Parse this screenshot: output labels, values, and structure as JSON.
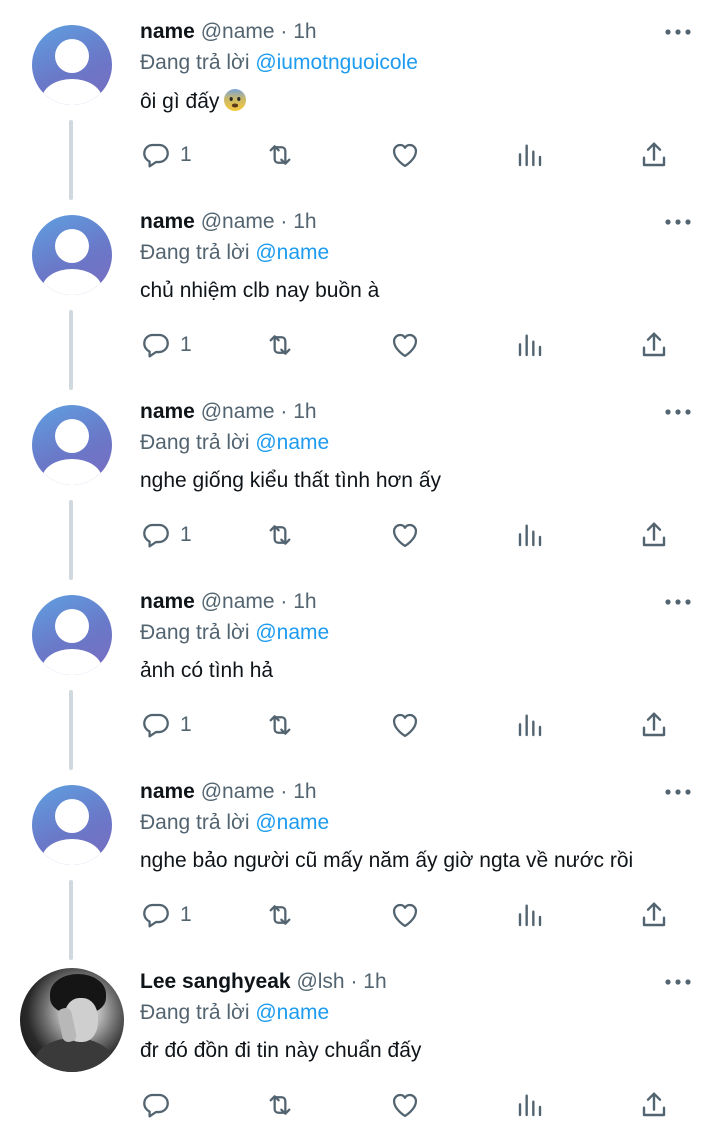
{
  "tweets": [
    {
      "name": "name",
      "handle": "@name",
      "time": "· 1h",
      "reply_prefix": "Đang trả lời",
      "reply_to": "@iumotnguoicole",
      "text": "ôi gì đấy",
      "emoji": "anxious-face-emoji",
      "reply_count": "1",
      "avatar": "default-avatar"
    },
    {
      "name": "name",
      "handle": "@name",
      "time": "· 1h",
      "reply_prefix": "Đang trả lời",
      "reply_to": "@name",
      "text": "chủ nhiệm clb nay buồn à",
      "reply_count": "1",
      "avatar": "default-avatar"
    },
    {
      "name": "name",
      "handle": "@name",
      "time": "· 1h",
      "reply_prefix": "Đang trả lời",
      "reply_to": "@name",
      "text": "nghe giống kiểu thất tình hơn ấy",
      "reply_count": "1",
      "avatar": "default-avatar"
    },
    {
      "name": "name",
      "handle": "@name",
      "time": "· 1h",
      "reply_prefix": "Đang trả lời",
      "reply_to": "@name",
      "text": "ảnh có tình hả",
      "reply_count": "1",
      "avatar": "default-avatar"
    },
    {
      "name": "name",
      "handle": "@name",
      "time": "· 1h",
      "reply_prefix": "Đang trả lời",
      "reply_to": "@name",
      "text": "nghe bảo người cũ mấy năm ấy giờ ngta về nước rồi",
      "reply_count": "1",
      "avatar": "default-avatar"
    },
    {
      "name": "Lee sanghyeak",
      "handle": "@lsh",
      "time": "· 1h",
      "reply_prefix": "Đang trả lời",
      "reply_to": "@name",
      "text": "đr đó đồn đi tin này chuẩn đấy",
      "reply_count": "",
      "avatar": "photo-avatar"
    }
  ],
  "icons": {
    "reply": "reply-icon",
    "retweet": "retweet-icon",
    "like": "heart-icon",
    "views": "views-chart-icon",
    "share": "share-icon",
    "more": "more-dots-icon"
  },
  "colors": {
    "mention": "#1d9bf0",
    "secondary_text": "#536471",
    "primary_text": "#0f1419",
    "thread_line": "#cfd9de"
  }
}
